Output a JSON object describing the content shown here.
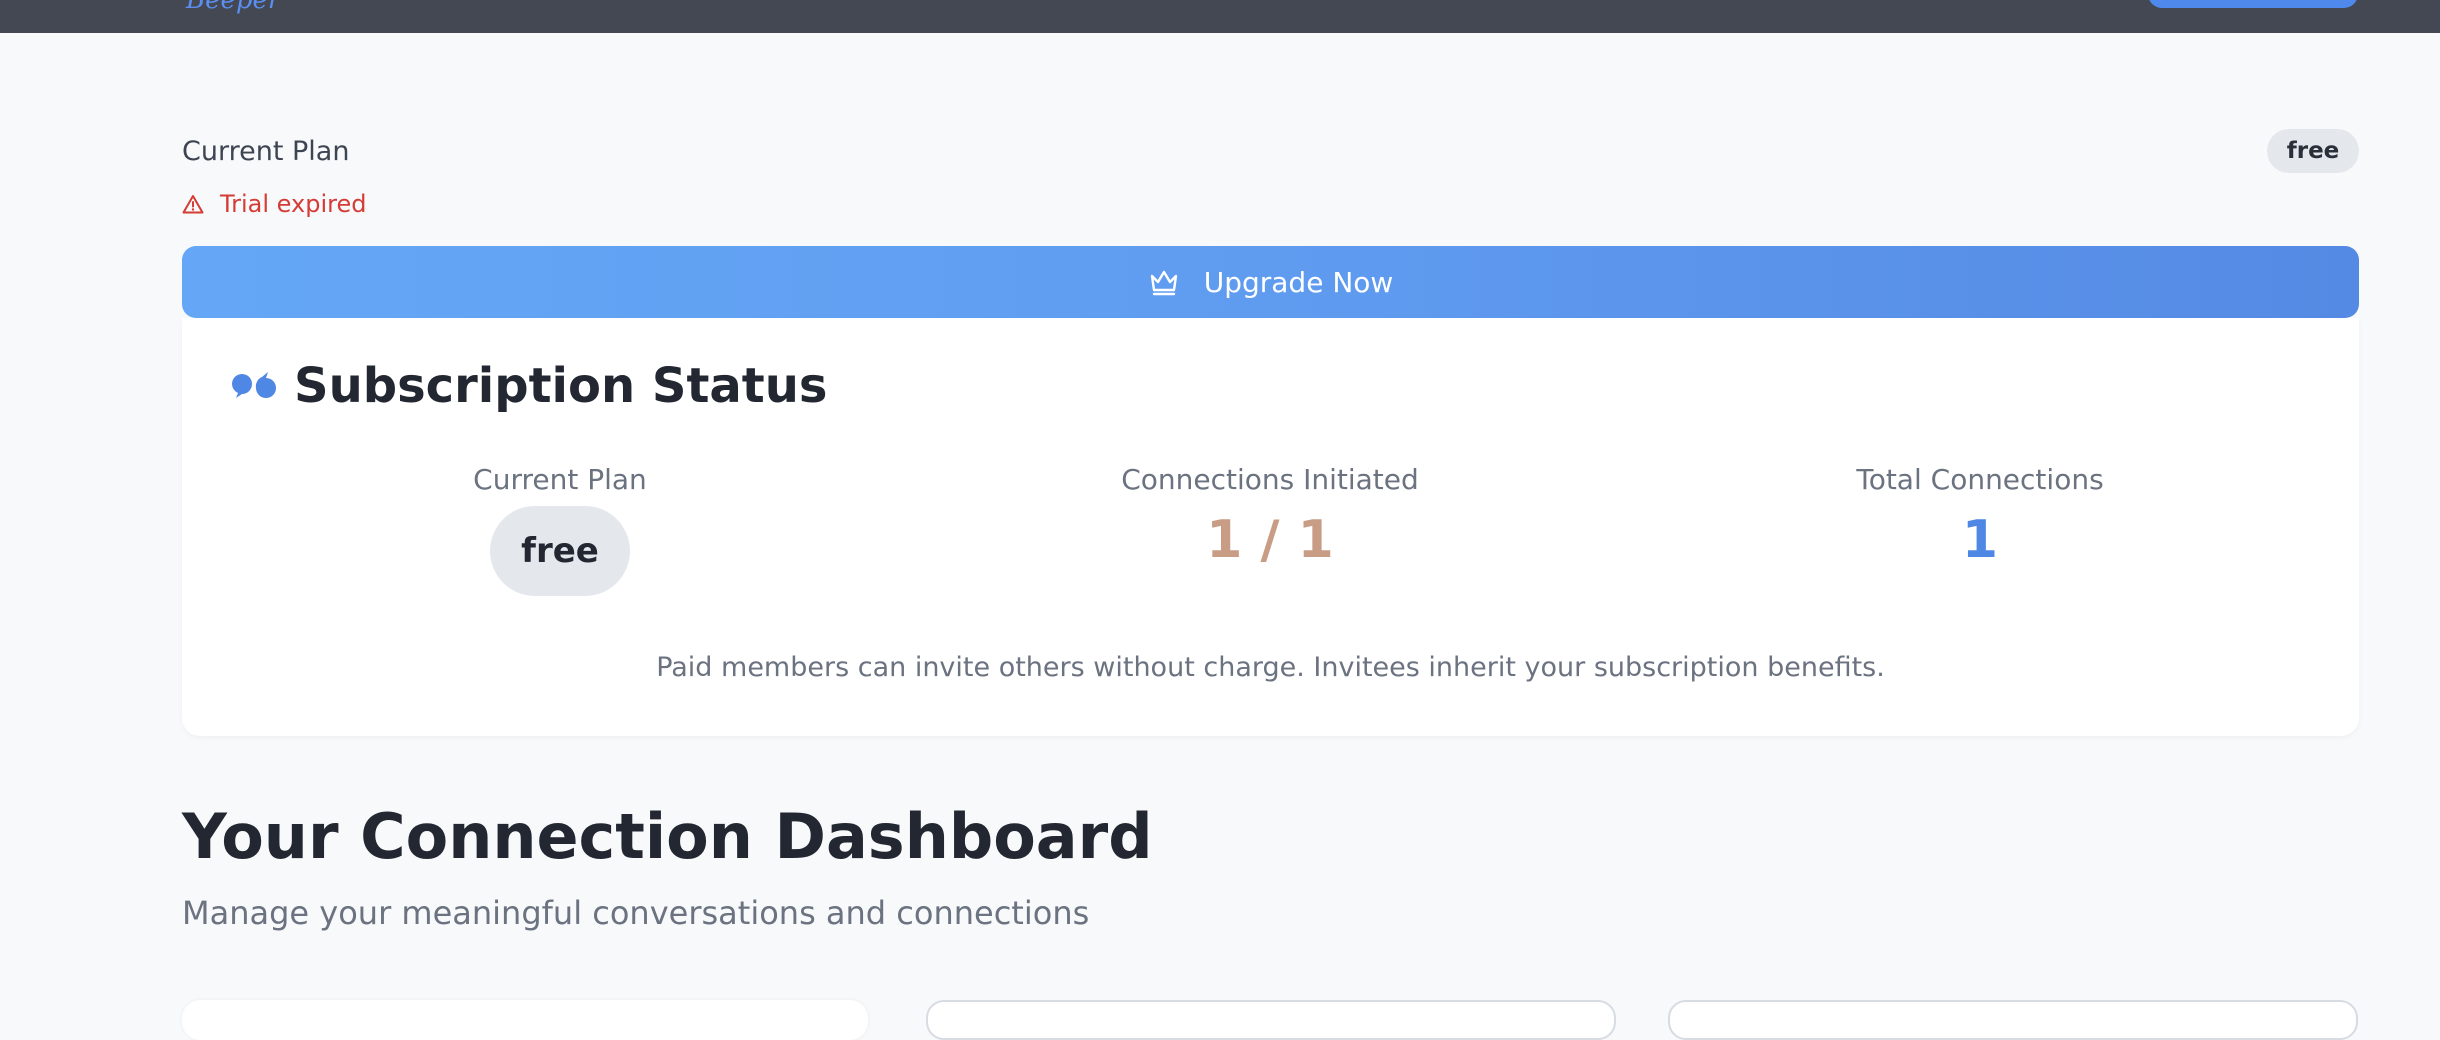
{
  "header": {
    "logo_text": "Beeper"
  },
  "plan": {
    "label": "Current Plan",
    "tag": "free",
    "trial_status": "Trial expired"
  },
  "upgrade": {
    "label": "Upgrade Now",
    "icon": "crown-icon"
  },
  "subscription": {
    "title": "Subscription Status",
    "icon": "chat-bubbles-icon",
    "stats": [
      {
        "label": "Current Plan",
        "value": "free"
      },
      {
        "label": "Connections Initiated",
        "value": "1 / 1"
      },
      {
        "label": "Total Connections",
        "value": "1"
      }
    ],
    "note": "Paid members can invite others without charge. Invitees inherit your subscription benefits."
  },
  "dashboard": {
    "title": "Your Connection Dashboard",
    "subtitle": "Manage your meaningful conversations and connections"
  },
  "colors": {
    "topbar": "#434852",
    "accent": "#5f9cf0",
    "warning": "#d43c35",
    "connections_value": "#c99d85",
    "total_value": "#4f87e4"
  }
}
